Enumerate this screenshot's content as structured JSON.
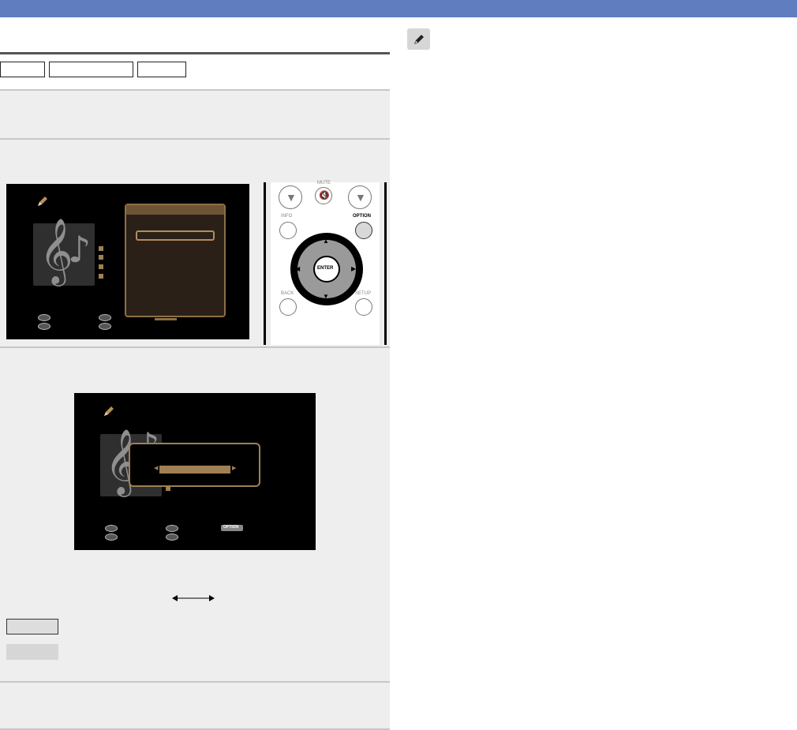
{
  "remote": {
    "mute_label": "MUTE",
    "info_label": "INFO",
    "option_label": "OPTION",
    "enter_label": "ENTER",
    "back_label": "BACK",
    "setup_label": "SETUP"
  },
  "screen2": {
    "option_key": "OPTION"
  },
  "colors": {
    "header_bar": "#5f7dbf",
    "menu_accent": "#a08053",
    "step_background": "#eeeeee"
  }
}
